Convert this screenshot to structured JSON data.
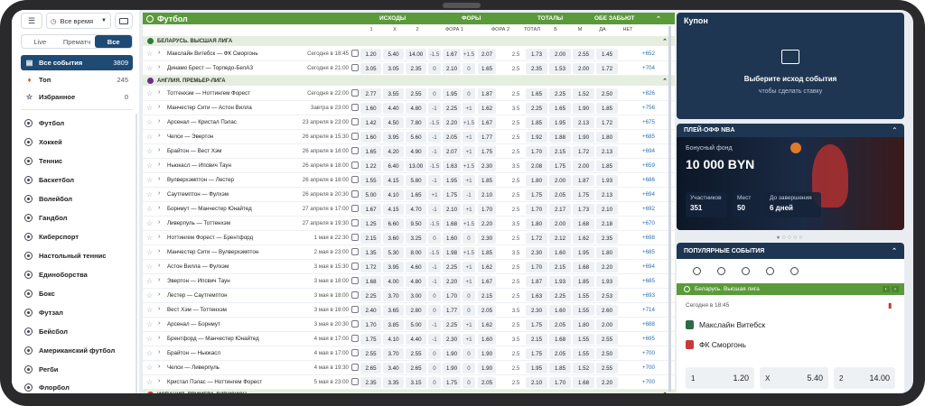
{
  "filters": {
    "time": "Все время"
  },
  "tabs": [
    "Live",
    "Прематч",
    "Все"
  ],
  "summary": [
    {
      "label": "Все события",
      "count": "3809"
    },
    {
      "label": "Топ",
      "count": "245"
    },
    {
      "label": "Избранное",
      "count": "0"
    }
  ],
  "sports": [
    "Футбол",
    "Хоккей",
    "Теннис",
    "Баскетбол",
    "Волейбол",
    "Гандбол",
    "Киберспорт",
    "Настольный теннис",
    "Единоборства",
    "Бокс",
    "Футзал",
    "Бейсбол",
    "Американский футбол",
    "Регби",
    "Флорбол"
  ],
  "main": {
    "title": "Футбол",
    "groups": [
      "ИСХОДЫ",
      "ФОРЫ",
      "ТОТАЛЫ",
      "ОБЕ ЗАБЬЮТ"
    ],
    "cols": [
      "1",
      "X",
      "2",
      "ФОРА 1",
      "ФОРА 2",
      "ТОТАЛ",
      "Б",
      "М",
      "ДА",
      "НЕТ"
    ]
  },
  "leagues": [
    "БЕЛАРУСЬ. ВЫСШАЯ ЛИГА",
    "АНГЛИЯ. ПРЕМЬЕР-ЛИГА",
    "ИСПАНИЯ. ПРИМЕРА ДИВИЗИОН"
  ],
  "matches": [
    {
      "teams": "Макслайн Витебск — ФК Сморгонь",
      "date": "Сегодня в 18:45",
      "o": [
        "1.20",
        "5.40",
        "14.00",
        "-1.5",
        "1.67",
        "+1.5",
        "2.07",
        "2.5",
        "1.73",
        "2.00",
        "2.55",
        "1.45"
      ],
      "more": "+652"
    },
    {
      "teams": "Динамо Брест — Торпедо-БелАЗ",
      "date": "Сегодня в 21:00",
      "o": [
        "3.05",
        "3.05",
        "2.35",
        "0",
        "2.10",
        "0",
        "1.65",
        "2.5",
        "2.35",
        "1.53",
        "2.00",
        "1.72"
      ],
      "more": "+704"
    },
    {
      "teams": "Тоттенхэм — Ноттингем Форест",
      "date": "Сегодня в 22:00",
      "o": [
        "2.77",
        "3.55",
        "2.55",
        "0",
        "1.95",
        "0",
        "1.87",
        "2.5",
        "1.65",
        "2.25",
        "1.52",
        "2.50"
      ],
      "more": "+826"
    },
    {
      "teams": "Манчестер Сити — Астон Вилла",
      "date": "Завтра в 23:00",
      "o": [
        "1.60",
        "4.40",
        "4.80",
        "-1",
        "2.25",
        "+1",
        "1.62",
        "3.5",
        "2.25",
        "1.65",
        "1.90",
        "1.85"
      ],
      "more": "+756"
    },
    {
      "teams": "Арсенал — Кристал Пэлас",
      "date": "23 апреля в 23:00",
      "o": [
        "1.42",
        "4.50",
        "7.80",
        "-1.5",
        "2.20",
        "+1.5",
        "1.67",
        "2.5",
        "1.85",
        "1.95",
        "2.13",
        "1.72"
      ],
      "more": "+675"
    },
    {
      "teams": "Челси — Эвертон",
      "date": "26 апреля в 15:30",
      "o": [
        "1.60",
        "3.95",
        "5.60",
        "-1",
        "2.05",
        "+1",
        "1.77",
        "2.5",
        "1.92",
        "1.88",
        "1.90",
        "1.80"
      ],
      "more": "+685"
    },
    {
      "teams": "Брайтон — Вест Хэм",
      "date": "26 апреля в 18:00",
      "o": [
        "1.65",
        "4.20",
        "4.90",
        "-1",
        "2.07",
        "+1",
        "1.75",
        "2.5",
        "1.70",
        "2.15",
        "1.72",
        "2.13"
      ],
      "more": "+694"
    },
    {
      "teams": "Ньюкасл — Ипсвич Таун",
      "date": "26 апреля в 18:00",
      "o": [
        "1.22",
        "6.40",
        "13.00",
        "-1.5",
        "1.63",
        "+1.5",
        "2.30",
        "3.5",
        "2.08",
        "1.75",
        "2.00",
        "1.85"
      ],
      "more": "+659"
    },
    {
      "teams": "Вулверхэмптон — Лестер",
      "date": "26 апреля в 18:00",
      "o": [
        "1.55",
        "4.15",
        "5.80",
        "-1",
        "1.95",
        "+1",
        "1.85",
        "2.5",
        "1.80",
        "2.00",
        "1.87",
        "1.93"
      ],
      "more": "+686"
    },
    {
      "teams": "Саутгемптон — Фулхэм",
      "date": "26 апреля в 20:30",
      "o": [
        "5.00",
        "4.10",
        "1.65",
        "+1",
        "1.75",
        "-1",
        "2.10",
        "2.5",
        "1.75",
        "2.05",
        "1.75",
        "2.13"
      ],
      "more": "+694"
    },
    {
      "teams": "Борнмут — Манчестер Юнайтед",
      "date": "27 апреля в 17:00",
      "o": [
        "1.67",
        "4.15",
        "4.70",
        "-1",
        "2.10",
        "+1",
        "1.70",
        "2.5",
        "1.70",
        "2.17",
        "1.73",
        "2.10"
      ],
      "more": "+692"
    },
    {
      "teams": "Ливерпуль — Тоттенхэм",
      "date": "27 апреля в 19:30",
      "o": [
        "1.25",
        "6.60",
        "9.50",
        "-1.5",
        "1.68",
        "+1.5",
        "2.20",
        "3.5",
        "1.80",
        "2.00",
        "1.68",
        "2.18"
      ],
      "more": "+670"
    },
    {
      "teams": "Ноттингем Форест — Брентфорд",
      "date": "1 мая в 22:30",
      "o": [
        "2.15",
        "3.60",
        "3.25",
        "0",
        "1.60",
        "0",
        "2.30",
        "2.5",
        "1.72",
        "2.12",
        "1.62",
        "2.35"
      ],
      "more": "+698"
    },
    {
      "teams": "Манчестер Сити — Вулверхэмптон",
      "date": "2 мая в 23:00",
      "o": [
        "1.35",
        "5.30",
        "8.00",
        "-1.5",
        "1.98",
        "+1.5",
        "1.85",
        "3.5",
        "2.30",
        "1.60",
        "1.95",
        "1.80"
      ],
      "more": "+685"
    },
    {
      "teams": "Астон Вилла — Фулхэм",
      "date": "3 мая в 15:30",
      "o": [
        "1.72",
        "3.95",
        "4.60",
        "-1",
        "2.25",
        "+1",
        "1.62",
        "2.5",
        "1.70",
        "2.15",
        "1.68",
        "2.20"
      ],
      "more": "+694"
    },
    {
      "teams": "Эвертон — Ипсвич Таун",
      "date": "3 мая в 18:00",
      "o": [
        "1.68",
        "4.00",
        "4.80",
        "-1",
        "2.20",
        "+1",
        "1.67",
        "2.5",
        "1.87",
        "1.93",
        "1.85",
        "1.93"
      ],
      "more": "+685"
    },
    {
      "teams": "Лестер — Саутгемптон",
      "date": "3 мая в 18:00",
      "o": [
        "2.25",
        "3.70",
        "3.00",
        "0",
        "1.70",
        "0",
        "2.15",
        "2.5",
        "1.63",
        "2.25",
        "1.55",
        "2.53"
      ],
      "more": "+693"
    },
    {
      "teams": "Вест Хэм — Тоттенхэм",
      "date": "3 мая в 18:00",
      "o": [
        "2.40",
        "3.65",
        "2.80",
        "0",
        "1.77",
        "0",
        "2.05",
        "3.5",
        "2.30",
        "1.60",
        "1.55",
        "2.60"
      ],
      "more": "+714"
    },
    {
      "teams": "Арсенал — Борнмут",
      "date": "3 мая в 20:30",
      "o": [
        "1.70",
        "3.85",
        "5.00",
        "-1",
        "2.25",
        "+1",
        "1.62",
        "2.5",
        "1.75",
        "2.05",
        "1.80",
        "2.00"
      ],
      "more": "+688"
    },
    {
      "teams": "Брентфорд — Манчестер Юнайтед",
      "date": "4 мая в 17:00",
      "o": [
        "1.75",
        "4.10",
        "4.40",
        "-1",
        "2.30",
        "+1",
        "1.60",
        "3.5",
        "2.15",
        "1.68",
        "1.55",
        "2.55"
      ],
      "more": "+695"
    },
    {
      "teams": "Брайтон — Ньюкасл",
      "date": "4 мая в 17:00",
      "o": [
        "2.55",
        "3.70",
        "2.55",
        "0",
        "1.90",
        "0",
        "1.90",
        "2.5",
        "1.75",
        "2.05",
        "1.55",
        "2.50"
      ],
      "more": "+700"
    },
    {
      "teams": "Челси — Ливерпуль",
      "date": "4 мая в 19:30",
      "o": [
        "2.65",
        "3.40",
        "2.65",
        "0",
        "1.90",
        "0",
        "1.90",
        "2.5",
        "1.95",
        "1.85",
        "1.52",
        "2.55"
      ],
      "more": "+700"
    },
    {
      "teams": "Кристал Пэлас — Ноттингем Форест",
      "date": "5 мая в 23:00",
      "o": [
        "2.35",
        "3.35",
        "3.15",
        "0",
        "1.75",
        "0",
        "2.05",
        "2.5",
        "2.10",
        "1.70",
        "1.68",
        "2.20"
      ],
      "more": "+700"
    }
  ],
  "coupon": {
    "title": "Купон",
    "main": "Выберите исход события",
    "sub": "чтобы сделать ставку"
  },
  "nba": {
    "title": "ПЛЕЙ-ОФФ NBA",
    "fund_label": "Бонусный фонд",
    "amount": "10 000 BYN",
    "stats": [
      {
        "label": "Участников",
        "value": "351"
      },
      {
        "label": "Мест",
        "value": "50"
      },
      {
        "label": "До завершения",
        "value": "6 дней"
      }
    ]
  },
  "popular": {
    "title": "ПОПУЛЯРНЫЕ СОБЫТИЯ",
    "league": "Беларусь. Высшая лига",
    "when": "Сегодня в 18:45",
    "team1": "Макслайн Витебск",
    "team2": "ФК Сморгонь",
    "odds": [
      {
        "label": "1",
        "value": "1.20"
      },
      {
        "label": "X",
        "value": "5.40"
      },
      {
        "label": "2",
        "value": "14.00"
      }
    ]
  }
}
